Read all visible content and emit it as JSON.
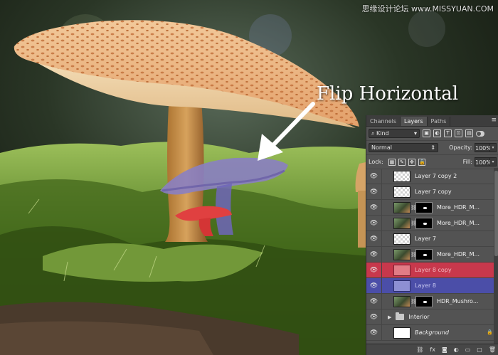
{
  "watermark": "思缘设计论坛 www.MISSYUAN.COM",
  "annotation": "Flip Horizontal",
  "panel": {
    "tabs": [
      {
        "label": "Channels",
        "active": false
      },
      {
        "label": "Layers",
        "active": true
      },
      {
        "label": "Paths",
        "active": false
      }
    ],
    "menu_icon": "panel-menu-icon",
    "filter": {
      "search_icon": "search-icon",
      "value": "Kind"
    },
    "blend_mode": "Normal",
    "opacity_label": "Opacity:",
    "opacity_value": "100%",
    "lock_label": "Lock:",
    "fill_label": "Fill:",
    "fill_value": "100%",
    "layers": [
      {
        "name": "Layer 7 copy 2",
        "type": "plain",
        "italic": false
      },
      {
        "name": "Layer 7 copy",
        "type": "plain",
        "italic": false
      },
      {
        "name": "More_HDR_M...",
        "type": "masked",
        "italic": false
      },
      {
        "name": "More_HDR_M...",
        "type": "masked",
        "italic": false
      },
      {
        "name": "Layer 7",
        "type": "plain",
        "italic": false
      },
      {
        "name": "More_HDR_M...",
        "type": "masked",
        "italic": false
      },
      {
        "name": "Layer 8 copy",
        "type": "red",
        "italic": false
      },
      {
        "name": "Layer 8",
        "type": "blue",
        "italic": false
      },
      {
        "name": "HDR_Mushro...",
        "type": "masked-photo",
        "italic": false
      },
      {
        "name": "Interior",
        "type": "group",
        "italic": false
      },
      {
        "name": "Background",
        "type": "background",
        "italic": true
      }
    ],
    "colors": {
      "panel": "#535353",
      "red_highlight": "#c8384c",
      "blue_highlight": "#4b4ea8"
    }
  }
}
